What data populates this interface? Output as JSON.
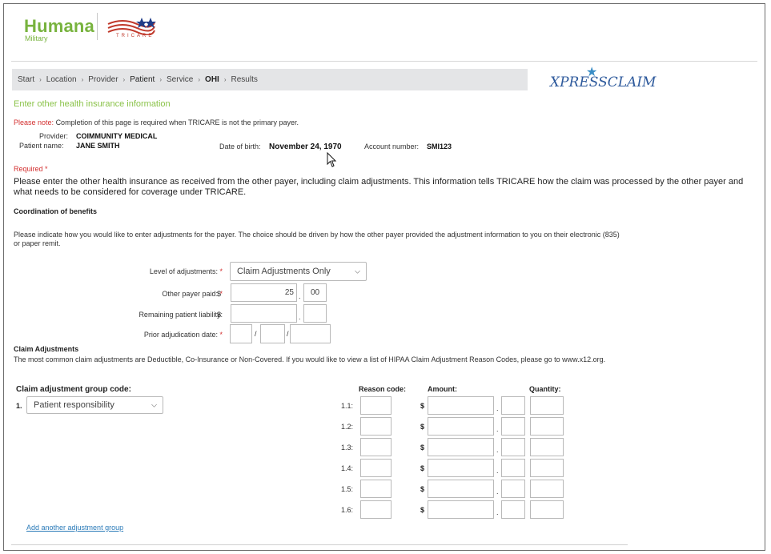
{
  "brand": {
    "name": "Humana",
    "sub": "Military",
    "partner_text": "TRICARE"
  },
  "breadcrumb": {
    "items": [
      "Start",
      "Location",
      "Provider",
      "Patient",
      "Service",
      "OHI",
      "Results"
    ],
    "bold_items": [
      "Patient",
      "OHI"
    ],
    "separator": "›"
  },
  "xpress_logo": "XPRESSCLAIM",
  "page": {
    "title": "Enter other health insurance information",
    "note_label": "Please note:",
    "note_text": "Completion of this page is required when TRICARE is not the primary payer.",
    "provider_label": "Provider:",
    "provider_value": "COIMMUNITY MEDICAL",
    "patient_label": "Patient name:",
    "patient_value": "JANE SMITH",
    "dob_label": "Date of birth:",
    "dob_value": "November 24, 1970",
    "account_label": "Account number:",
    "account_value": "SMI123",
    "required_label": "Required *",
    "intro": "Please enter the other health insurance as received from the other payer, including claim adjustments. This information tells TRICARE how the claim was processed by the other payer and what needs to be considered for coverage under TRICARE."
  },
  "cob": {
    "heading": "Coordination of benefits",
    "instructions": "Please indicate how you would like to enter adjustments for the payer. The choice should be driven by how the other payer provided the adjustment information to you on their electronic (835) or paper remit.",
    "level_label": "Level of adjustments:",
    "level_value": "Claim Adjustments Only",
    "paid_label": "Other payer paid:",
    "paid_dollars": "25",
    "paid_cents": "00",
    "liability_label": "Remaining patient liability:",
    "liability_dollars": "",
    "liability_cents": "",
    "prior_label": "Prior adjudication date:",
    "currency": "$",
    "star": "*",
    "date_sep": "/",
    "dot": "."
  },
  "claim_adjustments": {
    "heading": "Claim Adjustments",
    "description": "The most common claim adjustments are Deductible, Co-Insurance or Non-Covered. If you would like to view a list of HIPAA Claim Adjustment Reason Codes, please go to www.x12.org.",
    "group_code_label": "Claim adjustment group code:",
    "group_number": "1.",
    "group_value": "Patient responsibility",
    "reason_header": "Reason code:",
    "amount_header": "Amount:",
    "quantity_header": "Quantity:",
    "rows": [
      "1.1:",
      "1.2:",
      "1.3:",
      "1.4:",
      "1.5:",
      "1.6:"
    ],
    "currency": "$",
    "add_link": "Add another adjustment group"
  },
  "colors": {
    "brand_green": "#78b33e",
    "title_green": "#8bc34a",
    "required_red": "#d32f2f",
    "link_blue": "#2a7ab8",
    "breadcrumb_bg": "#e4e5e7"
  }
}
